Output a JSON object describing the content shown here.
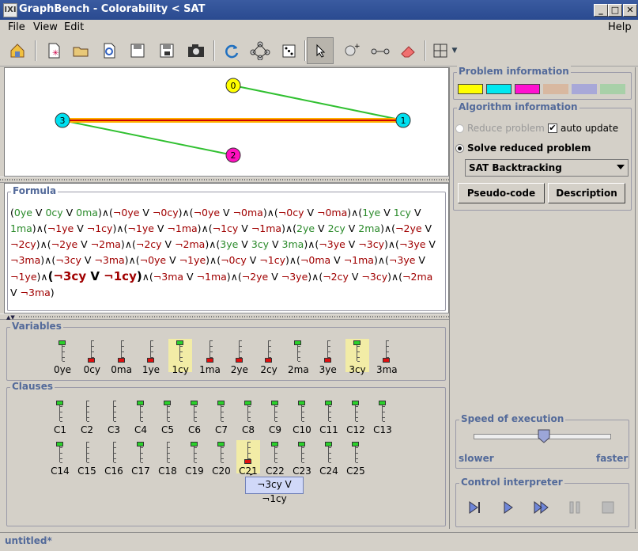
{
  "window": {
    "title": "GraphBench - Colorability < SAT",
    "logo": "IXI",
    "min": "_",
    "max": "□",
    "close": "✕"
  },
  "menu": {
    "file": "File",
    "view": "View",
    "edit": "Edit",
    "help": "Help"
  },
  "toolbar_icons": [
    "home-icon",
    "new-icon",
    "open-icon",
    "reload-icon",
    "save-icon",
    "save-as-icon",
    "screenshot-icon",
    "refresh-icon",
    "layout-icon",
    "random-icon",
    "select-pointer-icon",
    "add-node-icon",
    "add-edge-icon",
    "eraser-icon",
    "grid-icon"
  ],
  "graph": {
    "nodes": [
      {
        "label": "0",
        "color": "#ffff00"
      },
      {
        "label": "1",
        "color": "#00e0f0"
      },
      {
        "label": "2",
        "color": "#ff10c0"
      },
      {
        "label": "3",
        "color": "#00e0f0"
      }
    ]
  },
  "formula": {
    "title": "Formula",
    "clauses": [
      [
        "0ye",
        "0cy",
        "0ma"
      ],
      [
        "¬0ye",
        "¬0cy"
      ],
      [
        "¬0ye",
        "¬0ma"
      ],
      [
        "¬0cy",
        "¬0ma"
      ],
      [
        "1ye",
        "1cy",
        "1ma"
      ],
      [
        "¬1ye",
        "¬1cy"
      ],
      [
        "¬1ye",
        "¬1ma"
      ],
      [
        "¬1cy",
        "¬1ma"
      ],
      [
        "2ye",
        "2cy",
        "2ma"
      ],
      [
        "¬2ye",
        "¬2cy"
      ],
      [
        "¬2ye",
        "¬2ma"
      ],
      [
        "¬2cy",
        "¬2ma"
      ],
      [
        "3ye",
        "3cy",
        "3ma"
      ],
      [
        "¬3ye",
        "¬3cy"
      ],
      [
        "¬3ye",
        "¬3ma"
      ],
      [
        "¬3cy",
        "¬3ma"
      ],
      [
        "¬0ye",
        "¬1ye"
      ],
      [
        "¬0cy",
        "¬1cy"
      ],
      [
        "¬0ma",
        "¬1ma"
      ],
      [
        "¬3ye",
        "¬1ye"
      ],
      [
        "¬3cy",
        "¬1cy"
      ],
      [
        "¬3ma",
        "¬1ma"
      ],
      [
        "¬2ye",
        "¬3ye"
      ],
      [
        "¬2cy",
        "¬3cy"
      ],
      [
        "¬2ma",
        "¬3ma"
      ]
    ],
    "highlight_index": 20
  },
  "variables": {
    "title": "Variables",
    "items": [
      {
        "name": "0ye",
        "state": "true",
        "hl": false
      },
      {
        "name": "0cy",
        "state": "false",
        "hl": false
      },
      {
        "name": "0ma",
        "state": "false",
        "hl": false
      },
      {
        "name": "1ye",
        "state": "false",
        "hl": false
      },
      {
        "name": "1cy",
        "state": "true",
        "hl": true
      },
      {
        "name": "1ma",
        "state": "false",
        "hl": false
      },
      {
        "name": "2ye",
        "state": "false",
        "hl": false
      },
      {
        "name": "2cy",
        "state": "false",
        "hl": false
      },
      {
        "name": "2ma",
        "state": "true",
        "hl": false
      },
      {
        "name": "3ye",
        "state": "false",
        "hl": false
      },
      {
        "name": "3cy",
        "state": "true",
        "hl": true
      },
      {
        "name": "3ma",
        "state": "false",
        "hl": false
      }
    ]
  },
  "clauses": {
    "title": "Clauses",
    "row1": [
      {
        "name": "C1",
        "state": "true"
      },
      {
        "name": "C2",
        "state": "none"
      },
      {
        "name": "C3",
        "state": "none"
      },
      {
        "name": "C4",
        "state": "true"
      },
      {
        "name": "C5",
        "state": "true"
      },
      {
        "name": "C6",
        "state": "true"
      },
      {
        "name": "C7",
        "state": "true"
      },
      {
        "name": "C8",
        "state": "true"
      },
      {
        "name": "C9",
        "state": "true"
      },
      {
        "name": "C10",
        "state": "true"
      },
      {
        "name": "C11",
        "state": "true"
      },
      {
        "name": "C12",
        "state": "true"
      },
      {
        "name": "C13",
        "state": "true"
      }
    ],
    "row2": [
      {
        "name": "C14",
        "state": "true"
      },
      {
        "name": "C15",
        "state": "none"
      },
      {
        "name": "C16",
        "state": "none"
      },
      {
        "name": "C17",
        "state": "true"
      },
      {
        "name": "C18",
        "state": "none"
      },
      {
        "name": "C19",
        "state": "true"
      },
      {
        "name": "C20",
        "state": "true"
      },
      {
        "name": "C21",
        "state": "false"
      },
      {
        "name": "C22",
        "state": "true"
      },
      {
        "name": "C23",
        "state": "true"
      },
      {
        "name": "C24",
        "state": "true"
      },
      {
        "name": "C25",
        "state": "true"
      }
    ],
    "tooltip": "¬3cy V ¬1cy"
  },
  "problem_info": {
    "title": "Problem information",
    "swatches": [
      "#ffff00",
      "#00e8f0",
      "#ff10d0",
      "#d8b8a0",
      "#a8a8d8",
      "#a8d0a8"
    ]
  },
  "algorithm_info": {
    "title": "Algorithm information",
    "reduce_label": "Reduce problem",
    "auto_update_label": "auto update",
    "solve_label": "Solve reduced problem",
    "algorithm_selected": "SAT Backtracking",
    "pseudo_code": "Pseudo-code",
    "description": "Description"
  },
  "speed": {
    "title": "Speed of execution",
    "slower": "slower",
    "faster": "faster",
    "value": 0.52
  },
  "interpreter": {
    "title": "Control interpreter"
  },
  "status": {
    "text": "untitled*"
  }
}
